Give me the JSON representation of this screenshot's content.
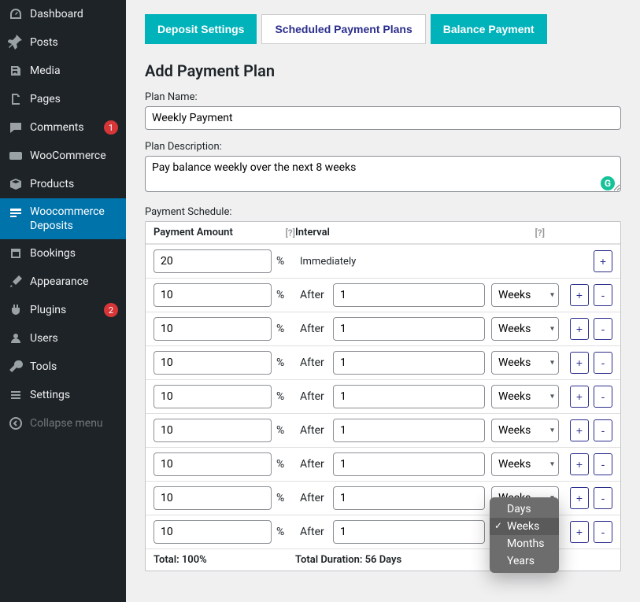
{
  "sidebar": {
    "items": [
      {
        "label": "Dashboard",
        "icon": "dashboard"
      },
      {
        "label": "Posts",
        "icon": "pin"
      },
      {
        "label": "Media",
        "icon": "media"
      },
      {
        "label": "Pages",
        "icon": "page"
      },
      {
        "label": "Comments",
        "icon": "comment",
        "badge": "1"
      },
      {
        "label": "WooCommerce",
        "icon": "woo"
      },
      {
        "label": "Products",
        "icon": "box"
      },
      {
        "label": "Woocommerce Deposits",
        "icon": "deposits",
        "active": true
      },
      {
        "label": "Bookings",
        "icon": "calendar"
      },
      {
        "label": "Appearance",
        "icon": "brush"
      },
      {
        "label": "Plugins",
        "icon": "plugin",
        "badge": "2"
      },
      {
        "label": "Users",
        "icon": "user"
      },
      {
        "label": "Tools",
        "icon": "wrench"
      },
      {
        "label": "Settings",
        "icon": "settings"
      }
    ],
    "collapse_label": "Collapse menu"
  },
  "tabs": [
    {
      "label": "Deposit Settings",
      "style": "teal"
    },
    {
      "label": "Scheduled Payment Plans",
      "style": "active"
    },
    {
      "label": "Balance Payment",
      "style": "teal"
    }
  ],
  "page_title": "Add Payment Plan",
  "form": {
    "plan_name_label": "Plan Name:",
    "plan_name_value": "Weekly Payment",
    "plan_desc_label": "Plan Description:",
    "plan_desc_value": "Pay balance weekly over the next 8 weeks",
    "schedule_label": "Payment Schedule:"
  },
  "schedule": {
    "amount_header": "Payment Amount",
    "interval_header": "Interval",
    "help_marker": "[?]",
    "percent_sign": "%",
    "after_label": "After",
    "immediately_label": "Immediately",
    "plus": "+",
    "minus": "-",
    "unit": "Weeks",
    "rows": [
      {
        "amount": "20",
        "immediate": true
      },
      {
        "amount": "10",
        "interval": "1",
        "unit": "Weeks"
      },
      {
        "amount": "10",
        "interval": "1",
        "unit": "Weeks"
      },
      {
        "amount": "10",
        "interval": "1",
        "unit": "Weeks"
      },
      {
        "amount": "10",
        "interval": "1",
        "unit": "Weeks"
      },
      {
        "amount": "10",
        "interval": "1",
        "unit": "Weeks"
      },
      {
        "amount": "10",
        "interval": "1",
        "unit": "Weeks"
      },
      {
        "amount": "10",
        "interval": "1",
        "unit": "Weeks"
      },
      {
        "amount": "10",
        "interval": "1",
        "unit": "Weeks"
      }
    ],
    "total_label": "Total: 100%",
    "duration_label": "Total Duration: 56 Days"
  },
  "dropdown": {
    "options": [
      "Days",
      "Weeks",
      "Months",
      "Years"
    ],
    "selected": "Weeks"
  },
  "grammarly_char": "G"
}
